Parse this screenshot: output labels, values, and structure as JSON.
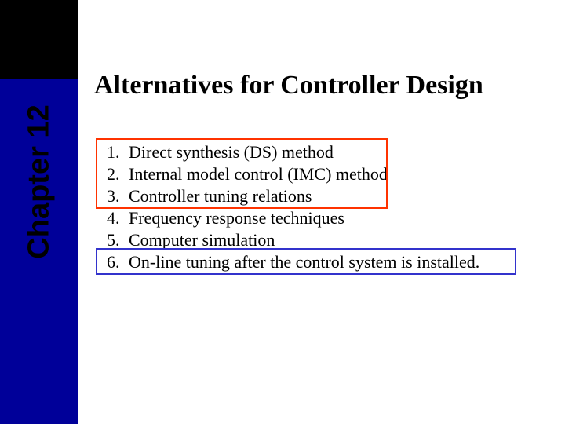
{
  "sidebar": {
    "chapter_label": "Chapter 12"
  },
  "content": {
    "title": "Alternatives for Controller Design",
    "items": [
      "Direct synthesis (DS) method",
      "Internal model control (IMC) method",
      "Controller tuning relations",
      "Frequency response techniques",
      "Computer simulation",
      "On-line tuning after the control system is installed."
    ]
  },
  "highlight": {
    "red_box_items": "1-3",
    "blue_box_item": "6"
  }
}
